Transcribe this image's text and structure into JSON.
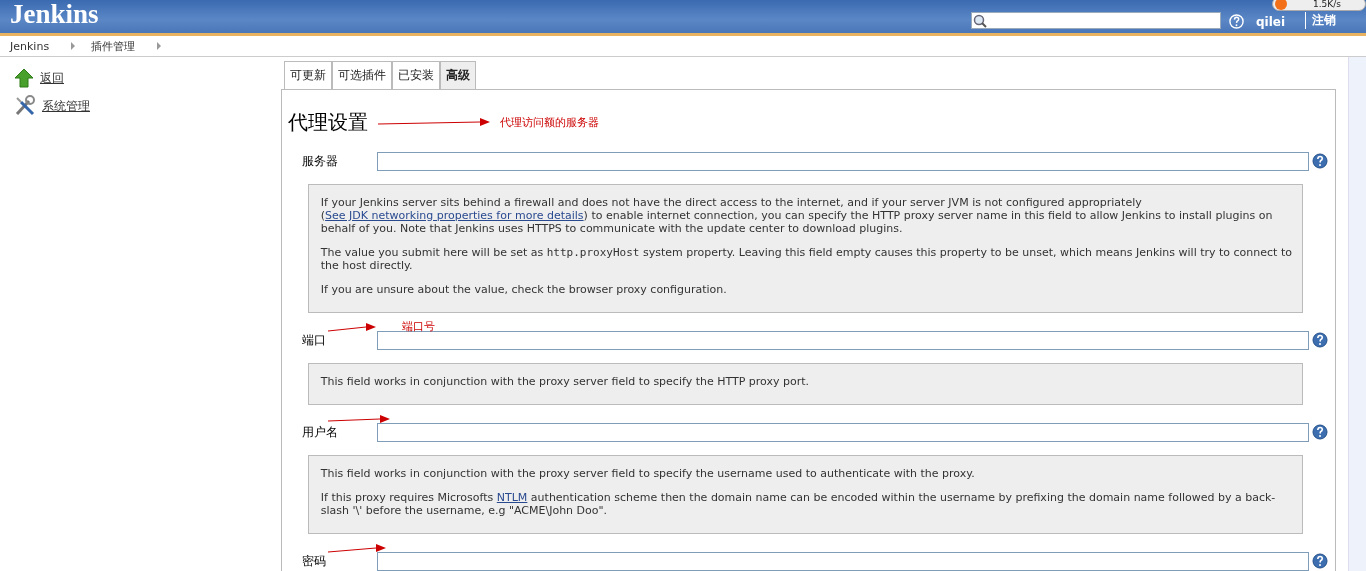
{
  "header": {
    "logo": "Jenkins",
    "user": "qilei",
    "logout": "注销"
  },
  "overlay": {
    "speed": "1.5K/s"
  },
  "breadcrumbs": [
    "Jenkins",
    "插件管理"
  ],
  "sidebar": {
    "items": [
      {
        "kind": "up",
        "label": "返回"
      },
      {
        "kind": "tools",
        "label": "系统管理"
      }
    ]
  },
  "tabs": [
    {
      "label": "可更新",
      "selected": false
    },
    {
      "label": "可选插件",
      "selected": false
    },
    {
      "label": "已安装",
      "selected": false
    },
    {
      "label": "高级",
      "selected": true
    }
  ],
  "section": {
    "title": "代理设置",
    "annotation": "代理访问额的服务器"
  },
  "fields": [
    {
      "label": "服务器",
      "arrow": false,
      "help": [
        [
          {
            "kind": "text",
            "text": "If your Jenkins server sits behind a firewall and does not have the direct access to the internet, and if your server JVM is not configured appropriately ("
          },
          {
            "kind": "link",
            "text": "See JDK networking properties for more details"
          },
          {
            "kind": "text",
            "text": ") to enable internet connection, you can specify the HTTP proxy server name in this field to allow Jenkins to install plugins on behalf of you. Note that Jenkins uses HTTPS to communicate with the update center to download plugins."
          }
        ],
        [
          {
            "kind": "text",
            "text": "The value you submit here will be set as "
          },
          {
            "kind": "code",
            "text": "http.proxyHost"
          },
          {
            "kind": "text",
            "text": " system property. Leaving this field empty causes this property to be unset, which means Jenkins will try to connect to the host directly."
          }
        ],
        [
          {
            "kind": "text",
            "text": "If you are unsure about the value, check the browser proxy configuration."
          }
        ]
      ]
    },
    {
      "label": "端口",
      "arrow": true,
      "annotation": "端口号",
      "help": [
        [
          {
            "kind": "text",
            "text": "This field works in conjunction with the proxy server field to specify the HTTP proxy port."
          }
        ]
      ]
    },
    {
      "label": "用户名",
      "arrow": true,
      "help": [
        [
          {
            "kind": "text",
            "text": "This field works in conjunction with the proxy server field to specify the username used to authenticate with the proxy."
          }
        ],
        [
          {
            "kind": "text",
            "text": "If this proxy requires Microsofts "
          },
          {
            "kind": "link",
            "text": "NTLM"
          },
          {
            "kind": "text",
            "text": " authentication scheme then the domain name can be encoded within the username by prefixing the domain name followed by a back-slash '\\' before the username, e.g \"ACME\\John Doo\"."
          }
        ]
      ]
    },
    {
      "label": "密码",
      "arrow": true
    }
  ]
}
